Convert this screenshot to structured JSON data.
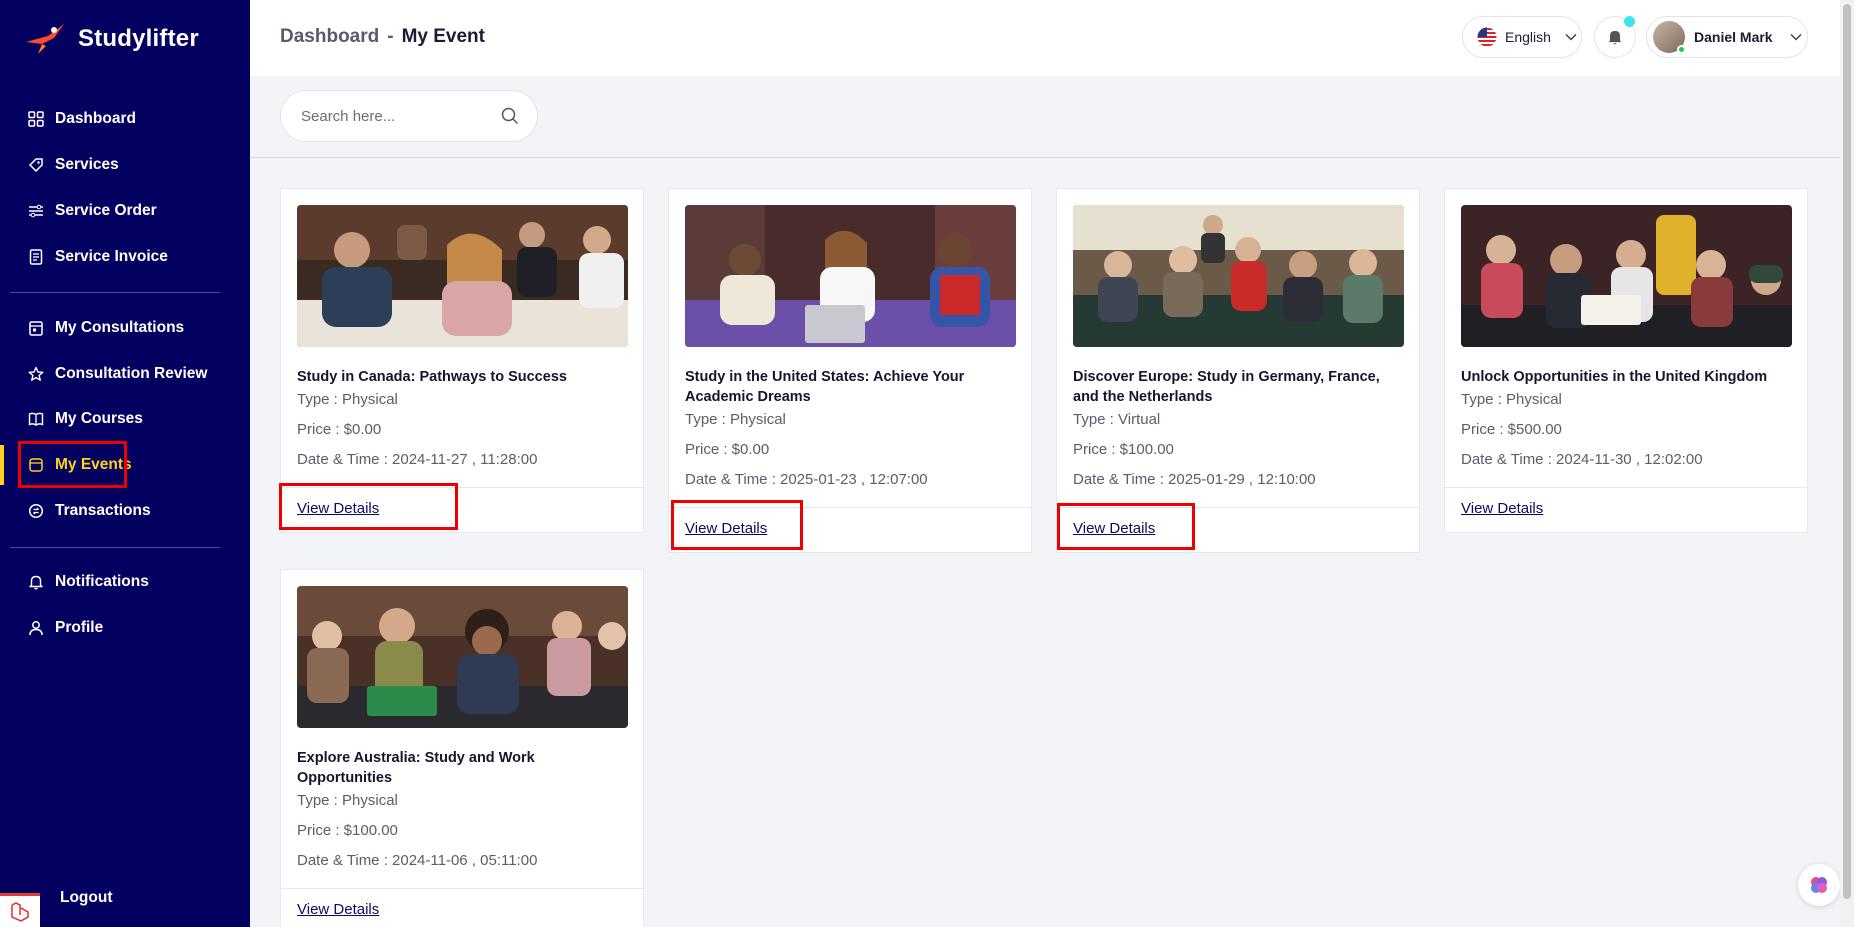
{
  "brand": {
    "name": "Studylifter"
  },
  "sidebar": {
    "items": [
      {
        "label": "Dashboard",
        "icon": "grid-icon"
      },
      {
        "label": "Services",
        "icon": "tag-icon"
      },
      {
        "label": "Service Order",
        "icon": "sliders-icon"
      },
      {
        "label": "Service Invoice",
        "icon": "invoice-icon"
      },
      {
        "label": "My Consultations",
        "icon": "calendar-icon"
      },
      {
        "label": "Consultation Review",
        "icon": "star-icon"
      },
      {
        "label": "My Courses",
        "icon": "book-icon"
      },
      {
        "label": "My Events",
        "icon": "events-icon"
      },
      {
        "label": "Transactions",
        "icon": "transactions-icon"
      },
      {
        "label": "Notifications",
        "icon": "bell-icon"
      },
      {
        "label": "Profile",
        "icon": "user-icon"
      }
    ],
    "logout": "Logout"
  },
  "header": {
    "breadcrumb_parent": "Dashboard",
    "breadcrumb_sep": "-",
    "breadcrumb_current": "My Event",
    "language": "English",
    "user_name": "Daniel Mark"
  },
  "search": {
    "placeholder": "Search here..."
  },
  "colors": {
    "sidebar": "#040060",
    "active": "#ffd21f",
    "highlight": "#ee0000"
  },
  "events": [
    {
      "title": "Study in Canada: Pathways to Success",
      "type": "Type : Physical",
      "price": "Price : $0.00",
      "datetime": "Date & Time : 2024-11-27 , 11:28:00",
      "link": "View Details"
    },
    {
      "title": "Study in the United States: Achieve Your Academic Dreams",
      "type": "Type : Physical",
      "price": "Price : $0.00",
      "datetime": "Date & Time : 2025-01-23 , 12:07:00",
      "link": "View Details"
    },
    {
      "title": "Discover Europe: Study in Germany, France, and the Netherlands",
      "type": "Type : Virtual",
      "price": "Price : $100.00",
      "datetime": "Date & Time : 2025-01-29 , 12:10:00",
      "link": "View Details"
    },
    {
      "title": "Unlock Opportunities in the United Kingdom",
      "type": "Type : Physical",
      "price": "Price : $500.00",
      "datetime": "Date & Time : 2024-11-30 , 12:02:00",
      "link": "View Details"
    },
    {
      "title": "Explore Australia: Study and Work Opportunities",
      "type": "Type : Physical",
      "price": "Price : $100.00",
      "datetime": "Date & Time : 2024-11-06 , 05:11:00",
      "link": "View Details"
    }
  ]
}
